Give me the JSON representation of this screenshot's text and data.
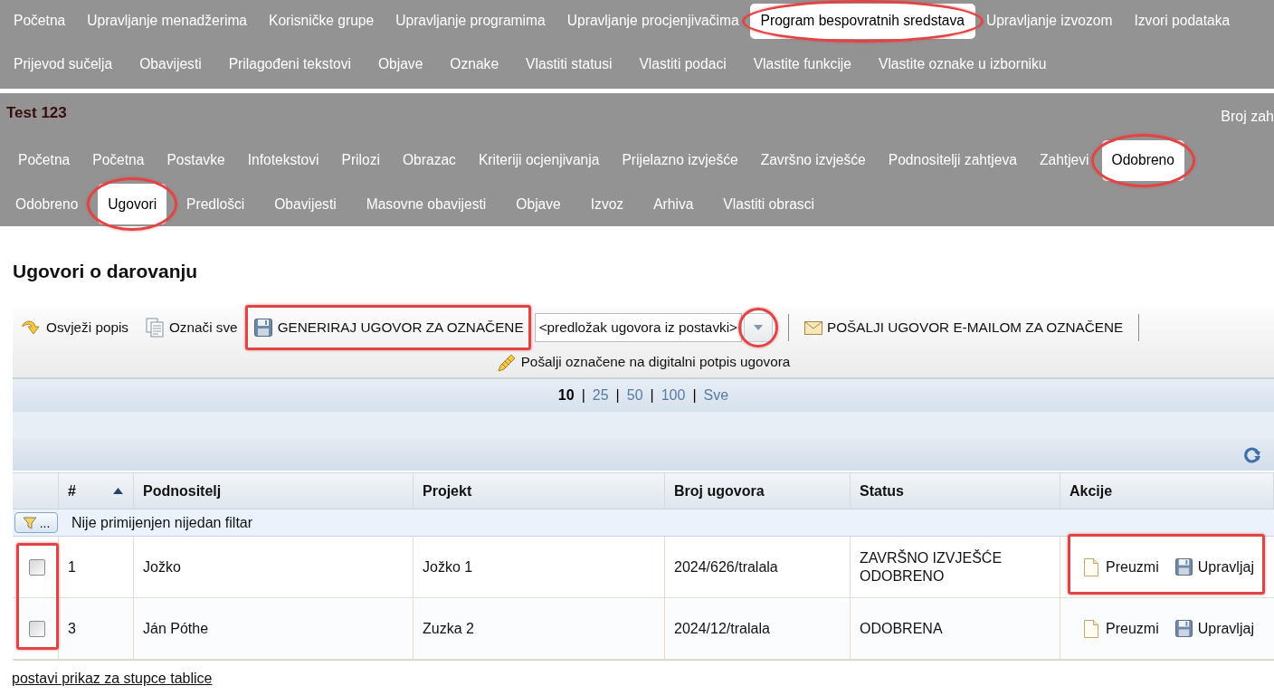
{
  "main_nav": {
    "rows": [
      {
        "items": [
          {
            "label": "Početna",
            "selected": false
          },
          {
            "label": "Upravljanje menadžerima",
            "selected": false
          },
          {
            "label": "Korisničke grupe",
            "selected": false
          },
          {
            "label": "Upravljanje programima",
            "selected": false
          },
          {
            "label": "Upravljanje procjenjivačima",
            "selected": false
          },
          {
            "label": "Program bespovratnih sredstava",
            "selected": true,
            "circled": true
          },
          {
            "label": "Upravljanje izvozom",
            "selected": false
          },
          {
            "label": "Izvori podataka",
            "selected": false
          }
        ]
      },
      {
        "items": [
          {
            "label": "Prijevod sučelja",
            "selected": false
          },
          {
            "label": "Obavijesti",
            "selected": false
          },
          {
            "label": "Prilagođeni tekstovi",
            "selected": false
          },
          {
            "label": "Objave",
            "selected": false
          },
          {
            "label": "Oznake",
            "selected": false
          },
          {
            "label": "Vlastiti statusi",
            "selected": false
          },
          {
            "label": "Vlastiti podaci",
            "selected": false
          },
          {
            "label": "Vlastite funkcije",
            "selected": false
          },
          {
            "label": "Vlastite oznake u izborniku",
            "selected": false
          }
        ]
      }
    ]
  },
  "program": {
    "title": "Test 123",
    "request_count_label": "Broj zah"
  },
  "tabs": {
    "rows": [
      {
        "items": [
          {
            "label": "Početna",
            "selected": false
          },
          {
            "label": "Početna",
            "selected": false
          },
          {
            "label": "Postavke",
            "selected": false
          },
          {
            "label": "Infotekstovi",
            "selected": false
          },
          {
            "label": "Prilozi",
            "selected": false
          },
          {
            "label": "Obrazac",
            "selected": false
          },
          {
            "label": "Kriteriji ocjenjivanja",
            "selected": false
          },
          {
            "label": "Prijelazno izvješće",
            "selected": false
          },
          {
            "label": "Završno izvješće",
            "selected": false
          },
          {
            "label": "Podnositelji zahtjeva",
            "selected": false
          },
          {
            "label": "Zahtjevi",
            "selected": false
          },
          {
            "label": "Odobreno",
            "selected": true,
            "circled": true
          }
        ]
      },
      {
        "items": [
          {
            "label": "Odobreno",
            "selected": false
          },
          {
            "label": "Ugovori",
            "selected": true,
            "circled": true
          },
          {
            "label": "Predlošci",
            "selected": false
          },
          {
            "label": "Obavijesti",
            "selected": false
          },
          {
            "label": "Masovne obavijesti",
            "selected": false
          },
          {
            "label": "Objave",
            "selected": false
          },
          {
            "label": "Izvoz",
            "selected": false
          },
          {
            "label": "Arhiva",
            "selected": false
          },
          {
            "label": "Vlastiti obrasci",
            "selected": false
          }
        ]
      }
    ]
  },
  "page_title": "Ugovori o darovanju",
  "toolbar": {
    "rows": [
      {
        "items": [
          {
            "kind": "refresh",
            "label": "Osvježi popis"
          },
          {
            "kind": "select_all",
            "label": "Označi sve"
          },
          {
            "kind": "generate",
            "label": "GENERIRAJ UGOVOR ZA OZNAČENE",
            "boxed": true
          },
          {
            "kind": "template_select",
            "value": "<predložak ugovora iz postavki>",
            "dropdown_circled": true
          },
          {
            "kind": "separator"
          },
          {
            "kind": "send_email",
            "label": "POŠALJI UGOVOR E-MAILOM ZA OZNAČENE"
          },
          {
            "kind": "separator"
          }
        ]
      },
      {
        "items": [
          {
            "kind": "digital_signature",
            "label": "Pošalji označene na digitalni potpis ugovora"
          }
        ]
      }
    ]
  },
  "pager": {
    "items": [
      {
        "kind": "option",
        "label": "10",
        "selected": true
      },
      {
        "kind": "separator",
        "label": "|"
      },
      {
        "kind": "option",
        "label": "25",
        "selected": false
      },
      {
        "kind": "separator",
        "label": "|"
      },
      {
        "kind": "option",
        "label": "50",
        "selected": false
      },
      {
        "kind": "separator",
        "label": "|"
      },
      {
        "kind": "option",
        "label": "100",
        "selected": false
      },
      {
        "kind": "separator",
        "label": "|"
      },
      {
        "kind": "option",
        "label": "Sve",
        "selected": false
      }
    ]
  },
  "table": {
    "columns": [
      {
        "kind": "select"
      },
      {
        "kind": "text",
        "label": "#",
        "sorted": true
      },
      {
        "kind": "text",
        "label": "Podnositelj",
        "sorted": false
      },
      {
        "kind": "text",
        "label": "Projekt",
        "sorted": false
      },
      {
        "kind": "text",
        "label": "Broj ugovora",
        "sorted": false
      },
      {
        "kind": "text",
        "label": "Status",
        "sorted": false
      },
      {
        "kind": "text",
        "label": "Akcije",
        "sorted": false
      }
    ],
    "filter": {
      "button_label": "...",
      "text": "Nije primijenjen nijedan filtar"
    },
    "checkboxes_boxed": true,
    "rows": [
      {
        "checked": false,
        "number": "1",
        "submitter": "Jožko",
        "project": "Jožko 1",
        "contract_number": "2024/626/tralala",
        "status": "ZAVRŠNO IZVJEŠĆE ODOBRENO",
        "actions": [
          {
            "kind": "download",
            "label": "Preuzmi"
          },
          {
            "kind": "manage",
            "label": "Upravljaj"
          }
        ],
        "actions_boxed": true
      },
      {
        "checked": false,
        "number": "3",
        "submitter": "Ján Póthe",
        "project": "Zuzka 2",
        "contract_number": "2024/12/tralala",
        "status": "ODOBRENA",
        "actions": [
          {
            "kind": "download",
            "label": "Preuzmi"
          },
          {
            "kind": "manage",
            "label": "Upravljaj"
          }
        ]
      }
    ]
  },
  "footer_link": "postavi prikaz za stupce tablice"
}
